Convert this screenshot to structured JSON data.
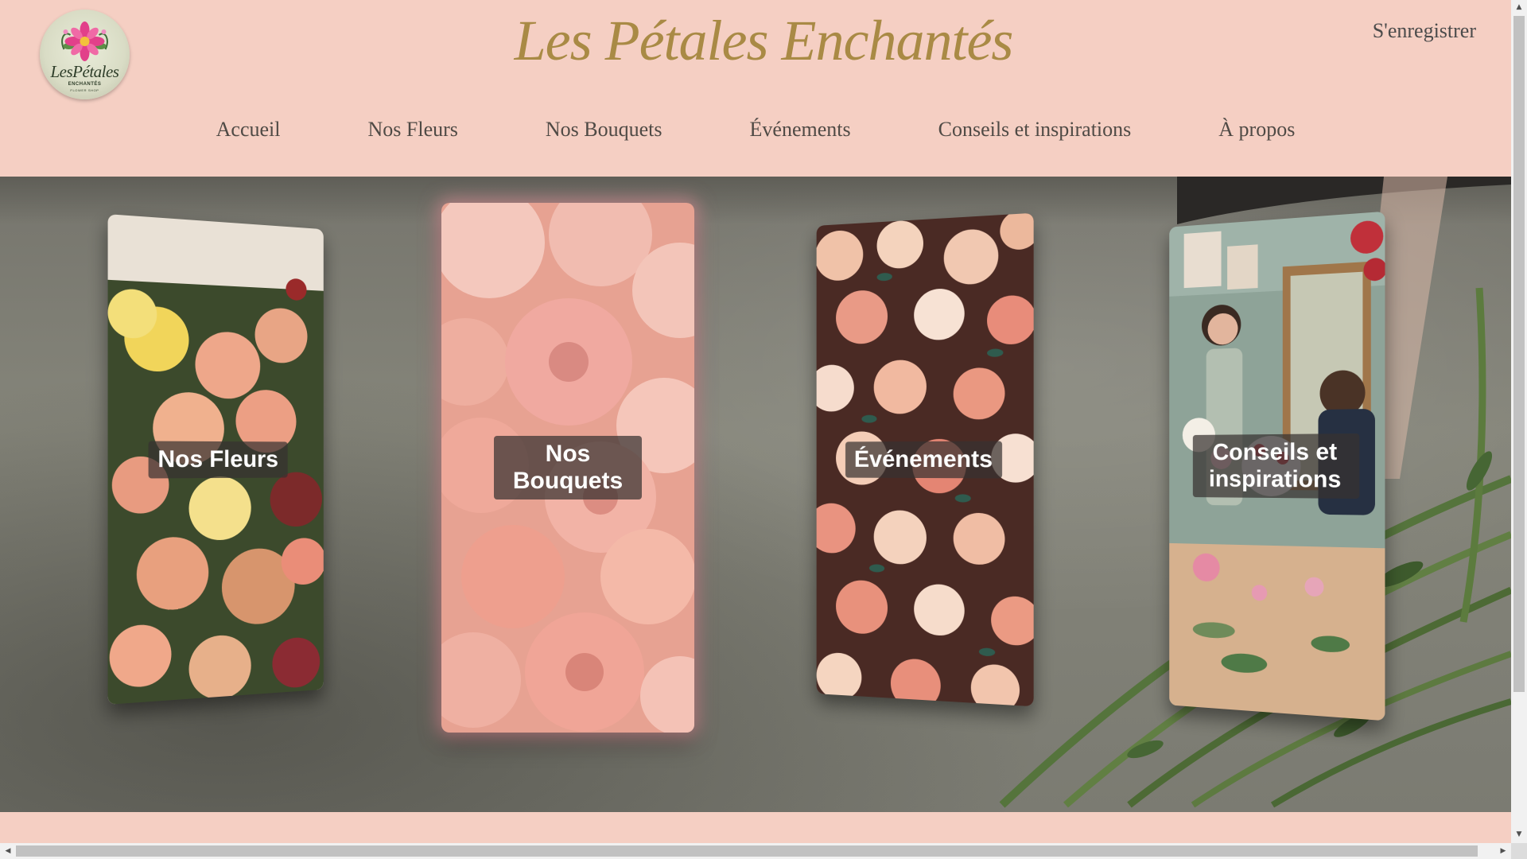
{
  "header": {
    "logo": {
      "text": "LesPétales",
      "sub": "ENCHANTÉS",
      "sub2": "FLOWER SHOP"
    },
    "title": "Les Pétales Enchantés",
    "register_label": "S'enregistrer",
    "nav": [
      {
        "label": "Accueil"
      },
      {
        "label": "Nos Fleurs"
      },
      {
        "label": "Nos Bouquets"
      },
      {
        "label": "Événements"
      },
      {
        "label": "Conseils et inspirations"
      },
      {
        "label": "À propos"
      }
    ]
  },
  "hero": {
    "cards": [
      {
        "label": "Nos Fleurs",
        "image": "mixed-flower-bouquet"
      },
      {
        "label": "Nos Bouquets",
        "image": "pink-peonies"
      },
      {
        "label": "Événements",
        "image": "rose-wall"
      },
      {
        "label": "Conseils et inspirations",
        "image": "florists-at-work"
      }
    ]
  },
  "colors": {
    "background": "#f5cfc3",
    "title": "#a98a45",
    "nav_text": "#4f4a45",
    "card_label_bg": "#37322f"
  }
}
